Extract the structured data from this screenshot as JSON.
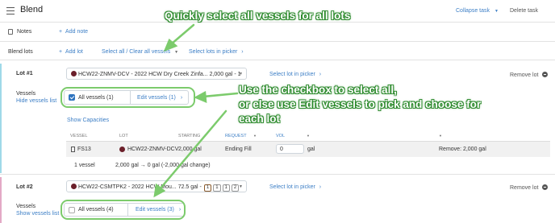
{
  "header": {
    "title": "Blend",
    "collapse_label": "Collapse task",
    "delete_label": "Delete task"
  },
  "notes": {
    "label": "Notes",
    "add_label": "Add note"
  },
  "blend_lots": {
    "label": "Blend lots",
    "add_lot_label": "Add lot",
    "select_all_label": "Select all / Clear all vessels",
    "select_picker_label": "Select lots in picker"
  },
  "lot1": {
    "label": "Lot #1",
    "lot_select": "HCW22-ZNMV-DCV - 2022 HCW Dry Creek Zinfa... 2,000 gal - 1",
    "select_picker": "Select lot in picker",
    "remove": "Remove lot",
    "vessels_label": "Vessels",
    "hide_vessels": "Hide vessels list",
    "all_vessels": "All vessels (1)",
    "edit_vessels": "Edit vessels (1)",
    "show_capacities": "Show Capacities",
    "table": {
      "headers": [
        "VESSEL",
        "LOT",
        "STARTING",
        "REQUEST",
        "VOL"
      ],
      "row": {
        "vessel": "FS13",
        "lot": "HCW22-ZNMV-DCV",
        "starting": "2,000 gal",
        "request": "Ending Fill",
        "vol": "0",
        "unit": "gal",
        "remove": "Remove: 2,000 gal"
      },
      "footer": {
        "count": "1 vessel",
        "change": "2,000 gal → 0 gal (-2,000 gal change)"
      }
    }
  },
  "lot2": {
    "label": "Lot #2",
    "lot_select": "HCW22-CSMTPK2 - 2022 HCW Mou... 72.5 gal -",
    "chips": [
      "1",
      "1",
      "1",
      "2"
    ],
    "select_picker": "Select lot in picker",
    "remove": "Remove lot",
    "vessels_label": "Vessels",
    "show_vessels": "Show vessels list",
    "all_vessels": "All vessels (4)",
    "edit_vessels": "Edit vessels (3)"
  },
  "annotations": {
    "top": "Quickly select all vessels for all lots",
    "middle_line1": "Use the checkbox to select all,",
    "middle_line2": "or else use Edit vessels to pick and choose for",
    "middle_line3": "each lot"
  },
  "colors": {
    "accent": "#3d7fc6",
    "annotation_green": "#7ccb6c",
    "lot_dot": "#6b1f2a"
  }
}
